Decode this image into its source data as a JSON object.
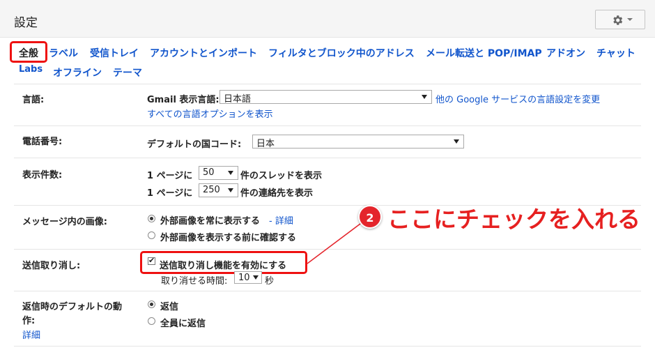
{
  "header": {
    "title": "設定"
  },
  "tabs": [
    {
      "label": "全般"
    },
    {
      "label": "ラベル"
    },
    {
      "label": "受信トレイ"
    },
    {
      "label": "アカウントとインポート"
    },
    {
      "label": "フィルタとブロック中のアドレス"
    },
    {
      "label": "メール転送と POP/IMAP"
    },
    {
      "label": "アドオン"
    },
    {
      "label": "チャット"
    },
    {
      "label": "Labs"
    },
    {
      "label": "オフライン"
    },
    {
      "label": "テーマ"
    }
  ],
  "language": {
    "label": "言語:",
    "display_label": "Gmail 表示言語:",
    "selected": "日本語",
    "other_link": "他の Google サービスの言語設定を変更",
    "all_options_link": "すべての言語オプションを表示"
  },
  "phone": {
    "label": "電話番号:",
    "country_label": "デフォルトの国コード:",
    "selected": "日本"
  },
  "page_size": {
    "label": "表示件数:",
    "row1_prefix": "1 ページに",
    "row1_value": "50",
    "row1_suffix": "件のスレッドを表示",
    "row2_prefix": "1 ページに",
    "row2_value": "250",
    "row2_suffix": "件の連絡先を表示"
  },
  "images": {
    "label": "メッセージ内の画像:",
    "option1": "外部画像を常に表示する",
    "option1_link": "- 詳細",
    "option2": "外部画像を表示する前に確認する"
  },
  "undo_send": {
    "label": "送信取り消し:",
    "checkbox_label": "送信取り消し機能を有効にする",
    "period_label": "取り消せる時間:",
    "period_value": "10",
    "period_unit": "秒"
  },
  "reply": {
    "label_line1": "返信時のデフォルトの動",
    "label_line2": "作:",
    "detail_link": "詳細",
    "option1": "返信",
    "option2": "全員に返信"
  },
  "annotation": {
    "step_number": "2",
    "text": "ここにチェックを入れる"
  },
  "colors": {
    "accent_red": "#e4252c",
    "link": "#1155cc"
  },
  "icons": {
    "settings": "gear-icon"
  }
}
